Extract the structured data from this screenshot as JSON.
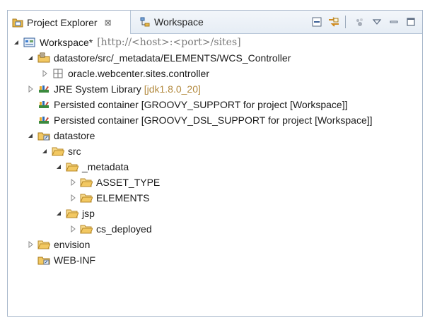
{
  "tabs": [
    {
      "label": "Project Explorer",
      "close_glyph": "⊠",
      "icon": "project-explorer-icon",
      "active": true
    },
    {
      "label": "Workspace",
      "icon": "workspace-icon",
      "active": false
    }
  ],
  "toolbar": {
    "icons": [
      "collapse-all-icon",
      "link-with-editor-icon",
      "filters-icon",
      "view-menu-icon",
      "minimize-icon",
      "maximize-icon"
    ]
  },
  "tree": {
    "workspace": {
      "label": "Workspace*",
      "url": "[http://<host>:<port>/sites]",
      "icon": "workspace-project-icon"
    },
    "metadata_src": {
      "label": "datastore/src/_metadata/ELEMENTS/WCS_Controller",
      "icon": "source-folder-icon"
    },
    "controller_pkg": {
      "label": "oracle.webcenter.sites.controller",
      "icon": "package-icon"
    },
    "jre": {
      "label": "JRE System Library",
      "decoration": "[jdk1.8.0_20]",
      "icon": "library-icon"
    },
    "groovy_support": {
      "label": "Persisted container [GROOVY_SUPPORT for project [Workspace]]",
      "icon": "library-icon"
    },
    "groovy_dsl": {
      "label": "Persisted container [GROOVY_DSL_SUPPORT for project [Workspace]]",
      "icon": "library-icon"
    },
    "datastore": {
      "label": "datastore",
      "icon": "linked-folder-icon"
    },
    "src": {
      "label": "src",
      "icon": "folder-icon"
    },
    "metadata": {
      "label": "_metadata",
      "icon": "folder-icon"
    },
    "asset_type": {
      "label": "ASSET_TYPE",
      "icon": "folder-icon"
    },
    "elements": {
      "label": "ELEMENTS",
      "icon": "folder-icon"
    },
    "jsp": {
      "label": "jsp",
      "icon": "folder-icon"
    },
    "cs_deployed": {
      "label": "cs_deployed",
      "icon": "folder-icon"
    },
    "envision": {
      "label": "envision",
      "icon": "folder-icon"
    },
    "webinf": {
      "label": "WEB-INF",
      "icon": "linked-folder-icon"
    }
  },
  "colors": {
    "tab_bar": "#e6edf5",
    "border": "#a9b8cb",
    "folder": "#e7b84a",
    "decoration": "#b38a3f",
    "url": "#7a7a7a"
  }
}
